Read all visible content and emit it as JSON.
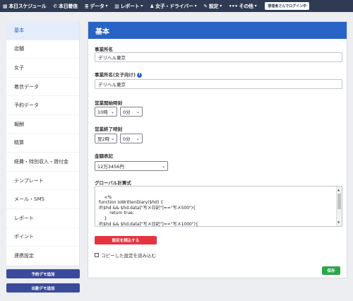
{
  "nav": {
    "today_schedule": "本日スケジュール",
    "today_calls": "本日着信",
    "data": "データ",
    "report": "レポート",
    "girls_drivers": "女子・ドライバー",
    "settings": "設定",
    "more": "その他",
    "login_status": "管理者さんでログイン中"
  },
  "sidebar": {
    "items": [
      "基本",
      "店舗",
      "女子",
      "着信データ",
      "予約データ",
      "報酬",
      "精算",
      "経費・特別収入・貸付金",
      "テンプレート",
      "メール・SMS",
      "レポート",
      "ポイント",
      "連携設定"
    ],
    "add_reservation_demo": "予約デモ追加",
    "add_attendance_demo": "出勤デモ追加"
  },
  "main": {
    "title": "基本",
    "business_name_label": "事業所名",
    "business_name_value": "デリヘル東京",
    "business_name_girls_label": "事業所名(女子向け)",
    "business_name_girls_value": "デリヘル東京",
    "open_time_label": "営業開始時刻",
    "open_hour": "10時",
    "open_minute": "0分",
    "close_time_label": "営業終了時刻",
    "close_hour": "翌2時",
    "close_minute": "0分",
    "amount_format_label": "金額表記",
    "amount_format_value": "12万3456円",
    "global_calc_label": "グローバル計算式",
    "global_calc_code": "<%\nfunction isWrittenDiary($hd) {\nif($hd && $hd.data[\"写メ日記\"]==\"写メ500\"){\n        return true;\n    }\nif($hd && $hd.data[\"写メ日記\"]==\"写メ1000\"){",
    "load_settings_button": "設定を読込する",
    "load_copied_checkbox": "コピーした設定を読み込む",
    "save_button": "保存"
  },
  "colors": {
    "nav_bg": "#2f3b52",
    "accent": "#2a63c6",
    "danger": "#e5333f",
    "success": "#2aa64b",
    "sidebar_button": "#3b4a9a"
  }
}
